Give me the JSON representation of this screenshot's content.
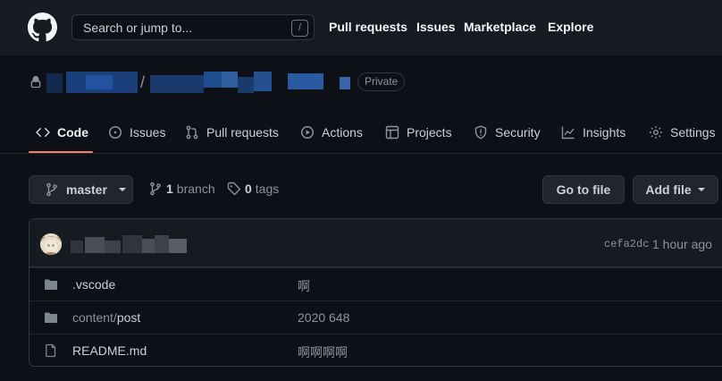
{
  "header": {
    "search_placeholder": "Search or jump to...",
    "search_shortcut": "/",
    "nav": [
      "Pull requests",
      "Issues",
      "Marketplace",
      "Explore"
    ]
  },
  "repo": {
    "separator": "/",
    "visibility": "Private"
  },
  "tabs": [
    {
      "label": "Code",
      "icon": "code-icon",
      "active": true
    },
    {
      "label": "Issues",
      "icon": "issue-icon"
    },
    {
      "label": "Pull requests",
      "icon": "pull-request-icon"
    },
    {
      "label": "Actions",
      "icon": "play-icon"
    },
    {
      "label": "Projects",
      "icon": "project-icon"
    },
    {
      "label": "Security",
      "icon": "shield-icon"
    },
    {
      "label": "Insights",
      "icon": "graph-icon"
    },
    {
      "label": "Settings",
      "icon": "gear-icon"
    }
  ],
  "toolbar": {
    "branch": "master",
    "branch_count": "1",
    "branch_label": "branch",
    "tag_count": "0",
    "tag_label": "tags",
    "go_to_file": "Go to file",
    "add_file": "Add file"
  },
  "commit": {
    "sha": "cefa2dc",
    "time": "1 hour ago"
  },
  "files": [
    {
      "type": "dir",
      "name": ".vscode",
      "message": "啊"
    },
    {
      "type": "dir",
      "name_dir": "content/",
      "name": "post",
      "message": "2020 648"
    },
    {
      "type": "file",
      "name": "README.md",
      "message": "啊啊啊啊"
    }
  ],
  "colors": {
    "accent_underline": "#f78166",
    "background": "#0d1117",
    "header": "#161b22"
  }
}
